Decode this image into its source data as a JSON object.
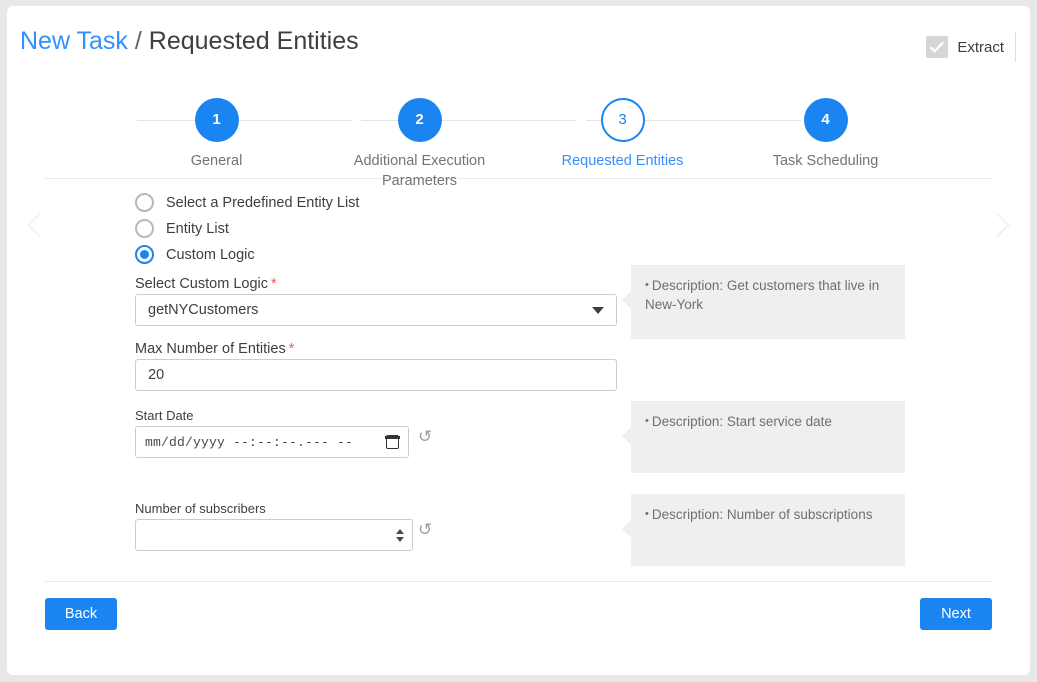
{
  "header": {
    "title_link": "New Task",
    "title_separator": "/",
    "title_current": "Requested Entities",
    "extract_label": "Extract",
    "extract_checked": true,
    "accent_color": "#1a85f0",
    "link_color": "#3390ff"
  },
  "stepper": {
    "steps": [
      {
        "number": "1",
        "label": "General",
        "state": "done"
      },
      {
        "number": "2",
        "label": "Additional Execution Parameters",
        "state": "done"
      },
      {
        "number": "3",
        "label": "Requested Entities",
        "state": "active"
      },
      {
        "number": "4",
        "label": "Task Scheduling",
        "state": "done"
      }
    ]
  },
  "form": {
    "entity_source_options": [
      {
        "label": "Select a Predefined Entity List",
        "selected": false
      },
      {
        "label": "Entity List",
        "selected": false
      },
      {
        "label": "Custom Logic",
        "selected": true
      }
    ],
    "custom_logic": {
      "label": "Select Custom Logic",
      "required_mark": "*",
      "value": "getNYCustomers"
    },
    "max_entities": {
      "label": "Max Number of Entities",
      "required_mark": "*",
      "value": "20"
    },
    "start_date": {
      "label": "Start Date",
      "value": "mm/dd/yyyy --:--:--.--- --",
      "reset_glyph": "↺"
    },
    "subscribers": {
      "label": "Number of subscribers",
      "value": "",
      "reset_glyph": "↺"
    },
    "descriptions": [
      {
        "text": "Description: Get customers that live in New-York",
        "bullet": "•"
      },
      {
        "text": "Description: Start service date",
        "bullet": "•"
      },
      {
        "text": "Description: Number of subscriptions",
        "bullet": "•"
      }
    ]
  },
  "footer": {
    "back_label": "Back",
    "next_label": "Next"
  }
}
